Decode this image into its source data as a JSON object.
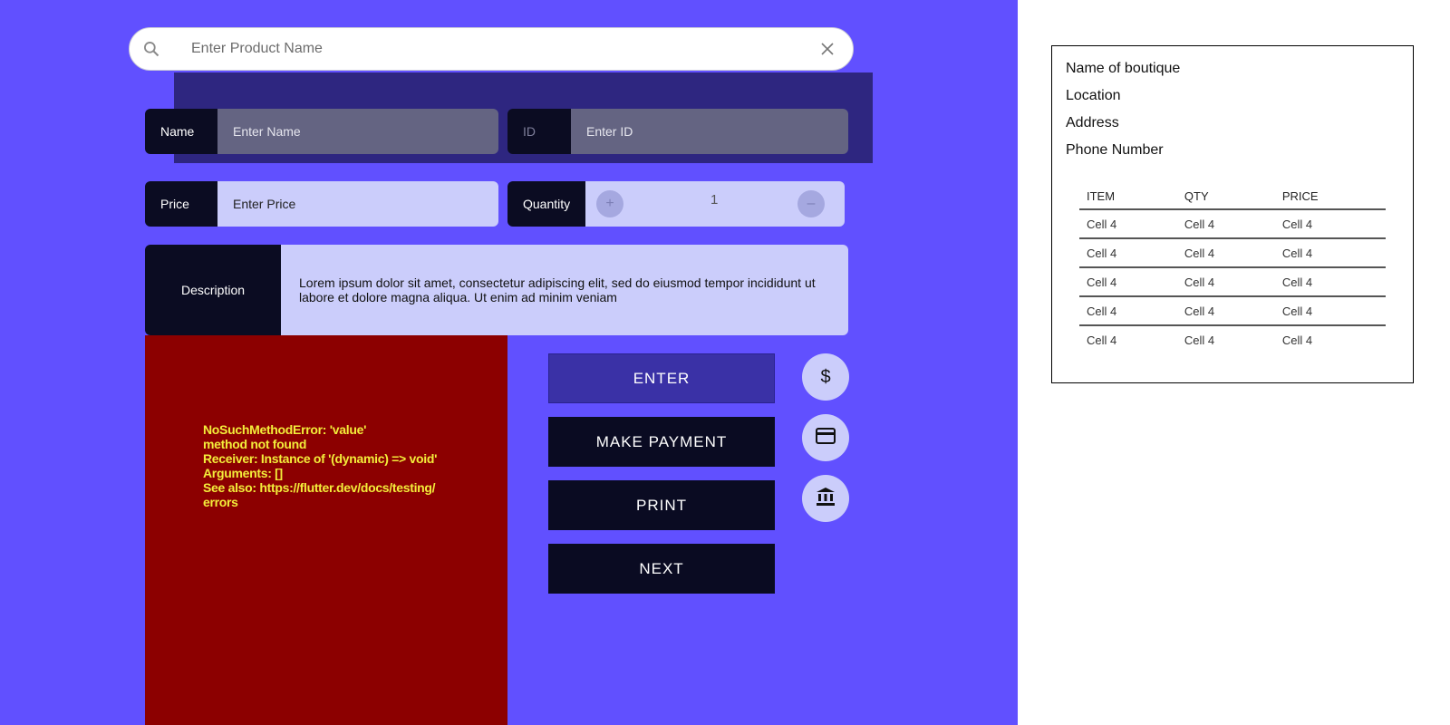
{
  "colors": {
    "background": "#6150ff",
    "dark_label": "#0b0c22",
    "light_field": "#cbcdfb",
    "error_bg": "#8c0000",
    "error_text": "#f3ed3a",
    "enter_button": "#3a31a6"
  },
  "search": {
    "placeholder": "Enter Product Name",
    "search_icon": "search-icon",
    "clear_icon": "close-icon"
  },
  "form": {
    "name": {
      "label": "Name",
      "placeholder": "Enter Name"
    },
    "id": {
      "label": "ID",
      "placeholder": "Enter ID"
    },
    "price": {
      "label": "Price",
      "placeholder": "Enter Price"
    },
    "quantity": {
      "label": "Quantity",
      "value": "1",
      "plus": "+",
      "minus": "–"
    },
    "description": {
      "label": "Description",
      "text": "Lorem ipsum dolor sit amet, consectetur adipiscing elit, sed do eiusmod tempor incididunt ut labore et dolore magna aliqua. Ut enim ad minim veniam"
    }
  },
  "error": {
    "message": "NoSuchMethodError: 'value'\nmethod not found\nReceiver: Instance of '(dynamic) => void'\nArguments: []\nSee also: https://flutter.dev/docs/testing/\nerrors"
  },
  "buttons": {
    "enter": "ENTER",
    "make_payment": "MAKE PAYMENT",
    "print": "PRINT",
    "next": "NEXT"
  },
  "payment_icons": {
    "cash": "$",
    "card": "credit-card-icon",
    "bank": "bank-icon"
  },
  "receipt": {
    "boutique_name": "Name of boutique",
    "location": "Location",
    "address": "Address",
    "phone": "Phone Number",
    "columns": [
      "ITEM",
      "QTY",
      "PRICE"
    ],
    "rows": [
      [
        "Cell 4",
        "Cell 4",
        "Cell 4"
      ],
      [
        "Cell 4",
        "Cell 4",
        "Cell 4"
      ],
      [
        "Cell 4",
        "Cell 4",
        "Cell 4"
      ],
      [
        "Cell 4",
        "Cell 4",
        "Cell 4"
      ],
      [
        "Cell 4",
        "Cell 4",
        "Cell 4"
      ]
    ]
  }
}
